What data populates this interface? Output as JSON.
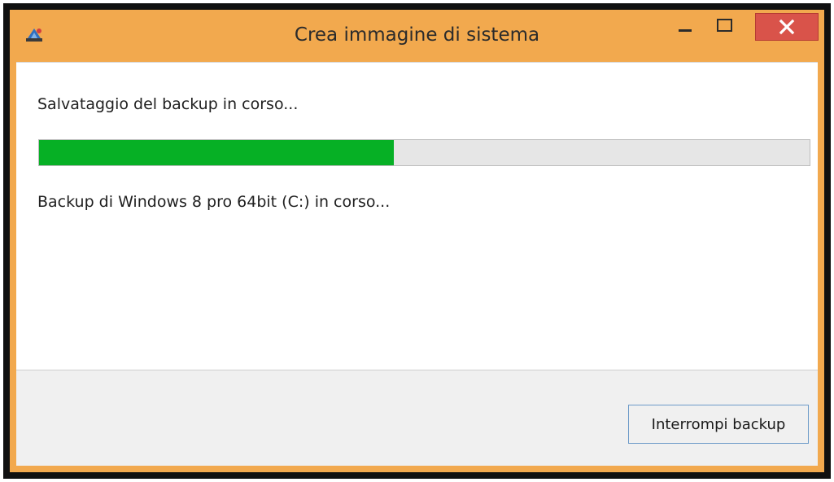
{
  "window": {
    "title": "Crea immagine di sistema",
    "icon": "system-image-backup-icon",
    "frame_color": "#f2a94e",
    "controls": {
      "minimize": "minimize-icon",
      "maximize": "maximize-icon",
      "close": "close-icon",
      "close_color": "#d9534a"
    }
  },
  "main": {
    "status_text": "Salvataggio del backup in corso...",
    "progress": {
      "percent": 46,
      "fill_color": "#06b025"
    },
    "detail_text": "Backup di Windows 8 pro 64bit (C:) in corso..."
  },
  "footer": {
    "stop_button_label": "Interrompi backup"
  }
}
